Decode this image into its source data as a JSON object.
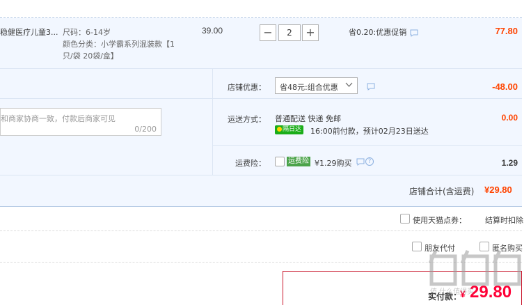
{
  "item": {
    "title": "稳健医疗儿童3...",
    "spec_size": "尺码：6-14岁",
    "spec_color": "颜色分类：小学霸系列混装款【1",
    "spec_color_2": "只/袋 20袋/盒】",
    "unit_price": "39.00",
    "quantity": "2",
    "discount_text": "省0.20:优惠促销",
    "subtotal": "77.80"
  },
  "shop_discount": {
    "label": "店铺优惠：",
    "selected": "省48元:组合优惠",
    "amount": "-48.00"
  },
  "message": {
    "placeholder": "和商家协商一致，付款后商家可见",
    "counter": "0/200"
  },
  "shipping": {
    "label": "运送方式：",
    "method": "普通配送 快递 免邮",
    "badge": "隔日达",
    "eta": "16:00前付款，预计02月23日送达",
    "cost": "0.00"
  },
  "insurance": {
    "label": "运费险：",
    "tag": "运费险",
    "price_text": "¥1.29购买",
    "amount": "1.29"
  },
  "shop_total": {
    "label": "店铺合计(含运费)",
    "amount": "¥29.80"
  },
  "points": {
    "label": "使用天猫点券：",
    "note": "结算时扣除"
  },
  "options": {
    "friend_pay": "朋友代付",
    "anonymous": "匿名购买"
  },
  "payment": {
    "label": "实付款：",
    "amount": "29.80",
    "currency": "¥"
  },
  "watermark": "值 什么值得买",
  "colors": {
    "accent": "#ff4400",
    "border": "#b6cae5",
    "row_bg": "#f2f7ff",
    "badge_green": "#1aad19",
    "payment_border": "#ff0036"
  }
}
